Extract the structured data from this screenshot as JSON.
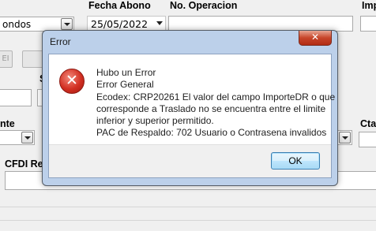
{
  "background": {
    "combo_left_value": "ondos",
    "fecha_abono_label": "Fecha Abono",
    "fecha_abono_value": "25/05/2022",
    "no_operacion_label": "No. Operacion",
    "imp_label": "Imp",
    "nte_label": "nte",
    "cta_label": "Cta",
    "cfdi_label": "CFDI Re",
    "s_label": "S",
    "disabled_button_label": "EI"
  },
  "dialog": {
    "title": "Error",
    "close_glyph": "✕",
    "icon": "error-icon",
    "lines": [
      "Hubo un Error",
      "Error General",
      "Ecodex: CRP20261 El valor del campo ImporteDR o que",
      "corresponde a Traslado no se encuentra entre el limite",
      "inferior y superior permitido.",
      "PAC de Respaldo: 702 Usuario o Contrasena invalidos"
    ],
    "ok_label": "OK"
  },
  "colors": {
    "dialog_frame": "#bcd0ea",
    "close_button": "#c7452a",
    "error_icon": "#d22f22",
    "ok_button_border": "#3c7fb1"
  }
}
